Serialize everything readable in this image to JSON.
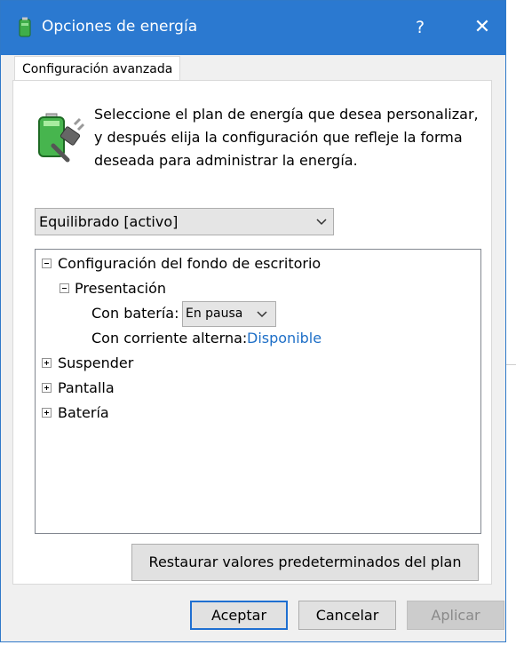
{
  "window": {
    "title": "Opciones de energía",
    "help_label": "?",
    "close_label": "✕"
  },
  "tab": {
    "label": "Configuración avanzada"
  },
  "intro_text": "Seleccione el plan de energía que desea personalizar, y después elija la configuración que refleje la forma deseada para administrar la energía.",
  "plan_select": {
    "value": "Equilibrado [activo]"
  },
  "tree": {
    "desktop_background": "Configuración del fondo de escritorio",
    "slideshow": "Presentación",
    "on_battery_label": "Con batería:",
    "on_battery_value": "En pausa",
    "plugged_in_label": "Con corriente alterna:",
    "plugged_in_value": "Disponible",
    "sleep": "Suspender",
    "display": "Pantalla",
    "battery": "Batería"
  },
  "buttons": {
    "restore": "Restaurar valores predeterminados del plan",
    "ok": "Aceptar",
    "cancel": "Cancelar",
    "apply": "Aplicar"
  },
  "colors": {
    "titlebar": "#2b79d0",
    "link": "#1e6fc7",
    "default_button_border": "#1f6fd1"
  }
}
